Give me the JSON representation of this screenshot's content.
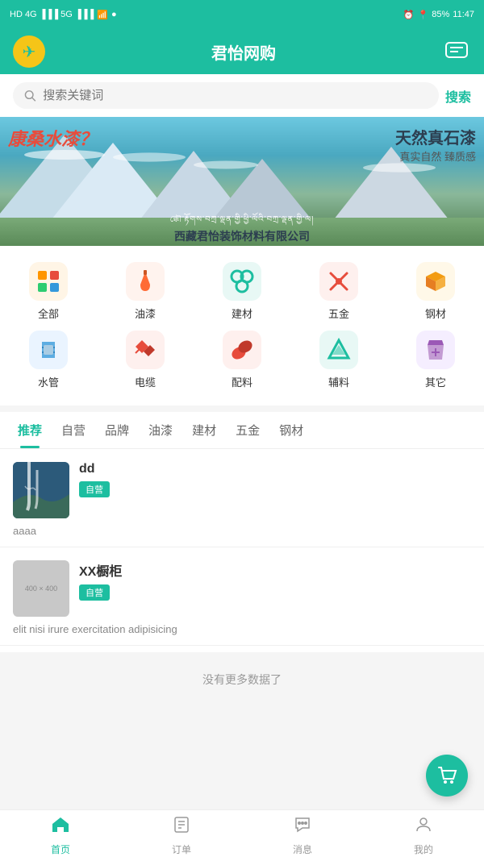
{
  "statusBar": {
    "left": "HD 4G  5G",
    "time": "11:47",
    "battery": "85%"
  },
  "header": {
    "title": "君怡网购",
    "logoSymbol": "✈",
    "chatIcon": "💬"
  },
  "search": {
    "placeholder": "搜索关键词",
    "buttonLabel": "搜索"
  },
  "banner": {
    "topLeft": "康桑水漆？",
    "mainText": "天然真石漆",
    "subText1": "真实自然 臻质感",
    "tibetanText": "ক্কৌ་རྟོགས་བཀྲ་ལྡན་གྱི་ཕྱི་ལོའི་བཀྲ་ལྡན་གྱི་ལ།",
    "companyName": "西藏君怡装饰材料有限公司"
  },
  "categories": {
    "row1": [
      {
        "id": "all",
        "label": "全部",
        "icon": "🟠",
        "color": "#ff9500"
      },
      {
        "id": "paint",
        "label": "油漆",
        "icon": "🪣",
        "color": "#ff6b35"
      },
      {
        "id": "building",
        "label": "建材",
        "icon": "⚙️",
        "color": "#1dbea0"
      },
      {
        "id": "hardware",
        "label": "五金",
        "icon": "🔧",
        "color": "#e74c3c"
      },
      {
        "id": "steel",
        "label": "钢材",
        "icon": "🔄",
        "color": "#f39c12"
      }
    ],
    "row2": [
      {
        "id": "pipe",
        "label": "水管",
        "icon": "👕",
        "color": "#3498db"
      },
      {
        "id": "cable",
        "label": "电缆",
        "icon": "🔀",
        "color": "#e74c3c"
      },
      {
        "id": "fittings",
        "label": "配料",
        "icon": "🎨",
        "color": "#e74c3c"
      },
      {
        "id": "auxiliary",
        "label": "辅料",
        "icon": "🔺",
        "color": "#1dbea0"
      },
      {
        "id": "other",
        "label": "其它",
        "icon": "🛍️",
        "color": "#9b59b6"
      }
    ]
  },
  "tabs": [
    {
      "id": "recommend",
      "label": "推荐",
      "active": true
    },
    {
      "id": "selfrun",
      "label": "自营",
      "active": false
    },
    {
      "id": "brand",
      "label": "品牌",
      "active": false
    },
    {
      "id": "paint",
      "label": "油漆",
      "active": false
    },
    {
      "id": "building",
      "label": "建材",
      "active": false
    },
    {
      "id": "hardware",
      "label": "五金",
      "active": false
    },
    {
      "id": "steel",
      "label": "钢材",
      "active": false
    }
  ],
  "products": [
    {
      "id": "p1",
      "name": "dd",
      "badge": "自营",
      "description": "aaaa",
      "hasThumb": true,
      "thumbType": "waterfall",
      "thumbText": ""
    },
    {
      "id": "p2",
      "name": "XX橱柜",
      "badge": "自营",
      "description": "elit nisi irure exercitation adipisicing",
      "hasThumb": true,
      "thumbType": "placeholder",
      "thumbText": "400×400"
    }
  ],
  "noMoreData": "没有更多数据了",
  "fab": {
    "icon": "🛒"
  },
  "bottomNav": [
    {
      "id": "home",
      "label": "首页",
      "icon": "🏠",
      "active": true
    },
    {
      "id": "order",
      "label": "订单",
      "icon": "📄",
      "active": false
    },
    {
      "id": "message",
      "label": "消息",
      "icon": "💬",
      "active": false
    },
    {
      "id": "profile",
      "label": "我的",
      "icon": "👤",
      "active": false
    }
  ]
}
